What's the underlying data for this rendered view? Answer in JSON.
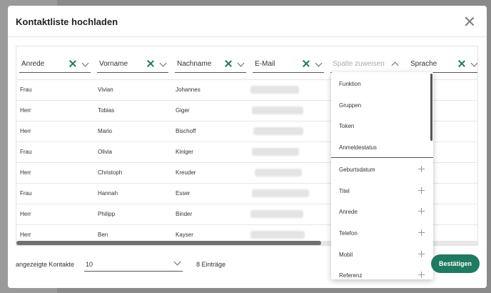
{
  "modal": {
    "title": "Kontaktliste hochladen"
  },
  "columns": [
    {
      "label": "Anrede",
      "type": "set"
    },
    {
      "label": "Vorname",
      "type": "set"
    },
    {
      "label": "Nachname",
      "type": "set"
    },
    {
      "label": "E-Mail",
      "type": "set"
    },
    {
      "label": "Spalte zuweisen",
      "type": "placeholder"
    },
    {
      "label": "Sprache",
      "type": "set"
    }
  ],
  "rows": [
    {
      "anrede": "Frau",
      "vorname": "Vivian",
      "nachname": "Johannes"
    },
    {
      "anrede": "Herr",
      "vorname": "Tobias",
      "nachname": "Giger"
    },
    {
      "anrede": "Herr",
      "vorname": "Mario",
      "nachname": "Bischoff"
    },
    {
      "anrede": "Frau",
      "vorname": "Olivia",
      "nachname": "Kiniger"
    },
    {
      "anrede": "Herr",
      "vorname": "Christoph",
      "nachname": "Kreuder"
    },
    {
      "anrede": "Frau",
      "vorname": "Hannah",
      "nachname": "Esser"
    },
    {
      "anrede": "Herr",
      "vorname": "Philipp",
      "nachname": "Binder"
    },
    {
      "anrede": "Herr",
      "vorname": "Ben",
      "nachname": "Kayser"
    }
  ],
  "dropdown": {
    "unused_options": [
      "Funktion",
      "Gruppen",
      "Token",
      "Anmeldestatus"
    ],
    "add_options": [
      "Geburtsdatum",
      "Titel",
      "Anrede",
      "Telefon",
      "Mobil",
      "Referenz"
    ]
  },
  "footer": {
    "shown_label": "angezeigte Kontakte",
    "rows_value": "10",
    "entries": "8 Einträge",
    "confirm_label": "Bestätigen"
  },
  "colors": {
    "accent": "#1e7a60"
  },
  "icons": [
    "close-icon",
    "clear-x-icon",
    "chevron-down-icon",
    "chevron-up-icon",
    "plus-icon"
  ]
}
